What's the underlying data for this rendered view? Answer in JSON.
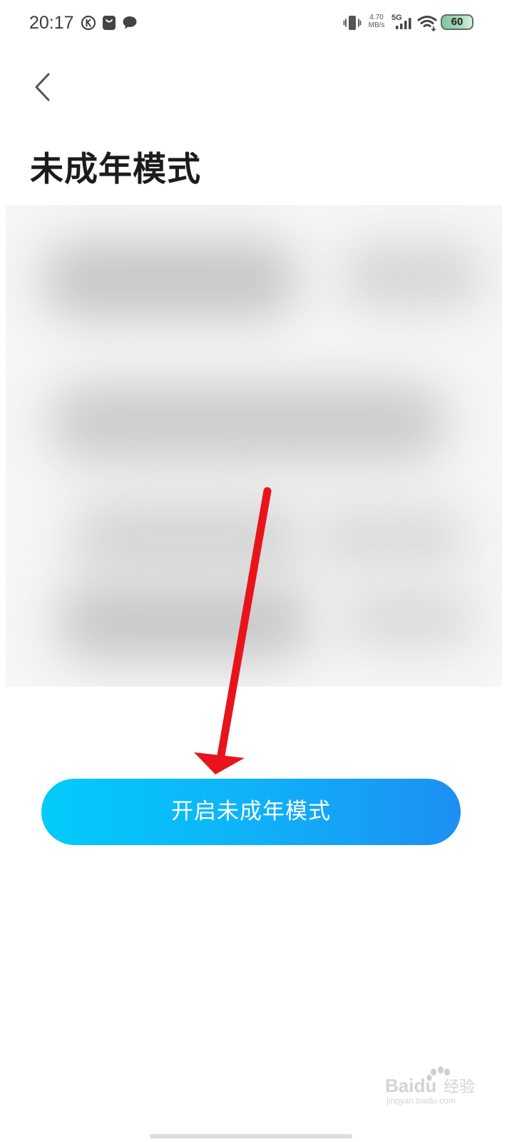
{
  "status_bar": {
    "time": "20:17",
    "network_speed_value": "4.70",
    "network_speed_unit": "MB/s",
    "network_type": "5G",
    "battery_level": "60",
    "icons": [
      "k-app-icon",
      "shopping-bag-icon",
      "chat-bubble-icon",
      "vibrate-icon",
      "cell-signal-icon",
      "wifi-icon",
      "battery-icon"
    ]
  },
  "header": {
    "back_icon": "chevron-left-icon",
    "title": "未成年模式"
  },
  "main": {
    "enable_button_label": "开启未成年模式"
  },
  "colors": {
    "button_gradient_start": "#02cbfa",
    "button_gradient_end": "#1c8ff3",
    "annotation_arrow": "#e8141b"
  },
  "watermark": {
    "brand": "Baidu",
    "brand_suffix": "经验",
    "url": "jingyan.baidu.com"
  }
}
